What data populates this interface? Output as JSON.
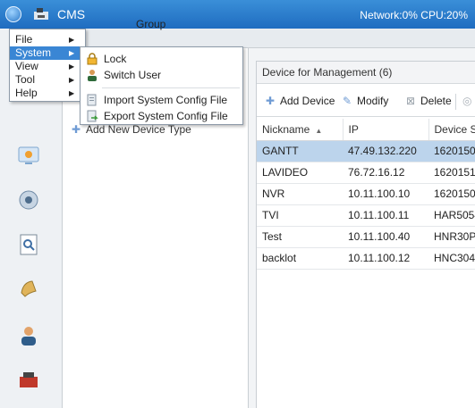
{
  "window": {
    "title": "CMS",
    "status": "Network:0% CPU:20%"
  },
  "top_tabs": {
    "group_label": "Group"
  },
  "tree": {
    "add_device_type": "Add New Device Type"
  },
  "device_panel": {
    "title": "Device for Management (6)",
    "toolbar": {
      "add": "Add Device",
      "modify": "Modify",
      "delete": "Delete"
    },
    "columns": [
      "Nickname",
      "IP",
      "Device S"
    ],
    "rows": [
      {
        "nickname": "GANTT",
        "ip": "47.49.132.220",
        "serial": "1620150",
        "selected": true
      },
      {
        "nickname": "LAVIDEO",
        "ip": "76.72.16.12",
        "serial": "1620151"
      },
      {
        "nickname": "NVR",
        "ip": "10.11.100.10",
        "serial": "1620150"
      },
      {
        "nickname": "TVI",
        "ip": "10.11.100.11",
        "serial": "HAR5054"
      },
      {
        "nickname": "Test",
        "ip": "10.11.100.40",
        "serial": "HNR30P"
      },
      {
        "nickname": "backlot",
        "ip": "10.11.100.12",
        "serial": "HNC304"
      }
    ]
  },
  "main_menu": {
    "items": [
      {
        "label": "File"
      },
      {
        "label": "System"
      },
      {
        "label": "View"
      },
      {
        "label": "Tool"
      },
      {
        "label": "Help"
      }
    ],
    "hovered": "System"
  },
  "system_submenu": {
    "items": [
      {
        "label": "Lock",
        "icon": "lock-icon"
      },
      {
        "label": "Switch User",
        "icon": "switch-user-icon"
      },
      {
        "label": "Import System Config File",
        "icon": "import-config-icon"
      },
      {
        "label": "Export System Config File",
        "icon": "export-config-icon"
      }
    ]
  },
  "colors": {
    "titlebar": "#2a7ccc",
    "selection": "#bcd4ec",
    "menu_hover": "#3a86d4"
  }
}
